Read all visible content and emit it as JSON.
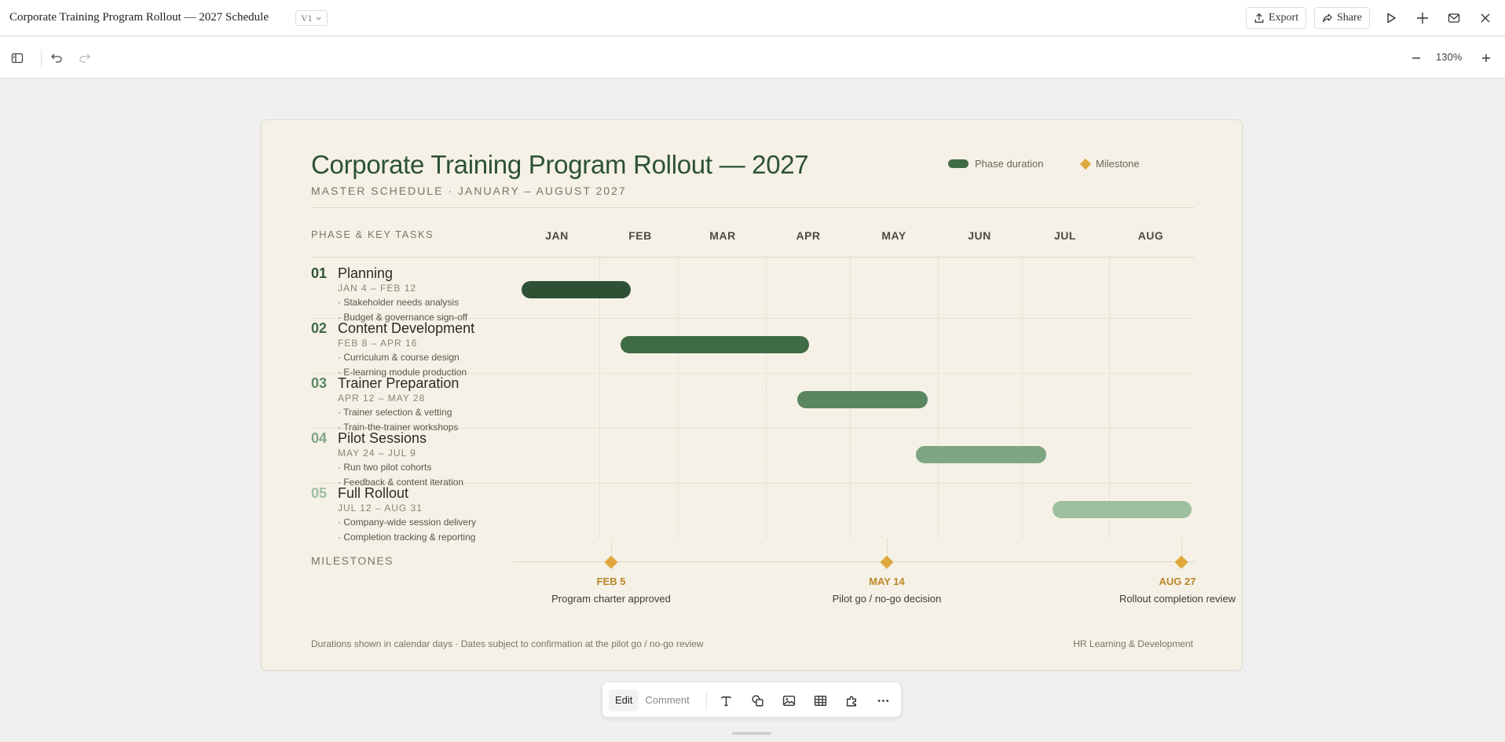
{
  "window": {
    "doc_title": "Corporate Training Program Rollout — 2027 Schedule",
    "version": "V1",
    "export_label": "Export",
    "share_label": "Share",
    "icons": [
      "upload-icon",
      "share-icon",
      "play-icon",
      "crosshair-icon",
      "mail-icon",
      "close-icon"
    ]
  },
  "toolbar": {
    "zoom": "130%",
    "icons": [
      "sidebar-icon",
      "undo-icon",
      "redo-icon",
      "zoom-out-icon",
      "zoom-in-icon"
    ]
  },
  "slide": {
    "title": "Corporate Training Program Rollout — 2027",
    "subtitle": "MASTER SCHEDULE · JANUARY – AUGUST 2027",
    "legend": {
      "duration": "Phase duration",
      "milestone": "Milestone"
    },
    "header_label": "PHASE & KEY TASKS",
    "months": [
      "JAN",
      "FEB",
      "MAR",
      "APR",
      "MAY",
      "JUN",
      "JUL",
      "AUG"
    ],
    "phases": [
      {
        "num": "01",
        "name": "Planning",
        "dates": "JAN 4 – FEB 12",
        "tasks": [
          "· Stakeholder needs analysis",
          "· Budget & governance sign-off"
        ],
        "color": "#2e5133"
      },
      {
        "num": "02",
        "name": "Content Development",
        "dates": "FEB 8 – APR 16",
        "tasks": [
          "· Curriculum & course design",
          "· E-learning module production"
        ],
        "color": "#3f6b45"
      },
      {
        "num": "03",
        "name": "Trainer Preparation",
        "dates": "APR 12 – MAY 28",
        "tasks": [
          "· Trainer selection & vetting",
          "· Train-the-trainer workshops"
        ],
        "color": "#5a8760"
      },
      {
        "num": "04",
        "name": "Pilot Sessions",
        "dates": "MAY 24 – JUL 9",
        "tasks": [
          "· Run two pilot cohorts",
          "· Feedback & content iteration"
        ],
        "color": "#7ea683"
      },
      {
        "num": "05",
        "name": "Full Rollout",
        "dates": "JUL 12 – AUG 31",
        "tasks": [
          "· Company-wide session delivery",
          "· Completion tracking & reporting"
        ],
        "color": "#9dbf9f"
      }
    ],
    "milestones_label": "MILESTONES",
    "milestones": [
      {
        "date": "FEB 5",
        "desc": "Program charter approved"
      },
      {
        "date": "MAY 14",
        "desc": "Pilot go / no-go decision"
      },
      {
        "date": "AUG 27",
        "desc": "Rollout completion review"
      }
    ],
    "footer_left": "Durations shown in calendar days · Dates subject to confirmation at the pilot go / no-go review",
    "footer_right": "HR Learning & Development",
    "colors": {
      "milestone": "#e0a83c",
      "title": "#2d5233",
      "background": "#f5f1e6"
    }
  },
  "bottom_toolbar": {
    "edit_label": "Edit",
    "comment_label": "Comment",
    "icons": [
      "text-icon",
      "shapes-icon",
      "image-icon",
      "table-icon",
      "plugin-icon",
      "more-icon"
    ]
  }
}
